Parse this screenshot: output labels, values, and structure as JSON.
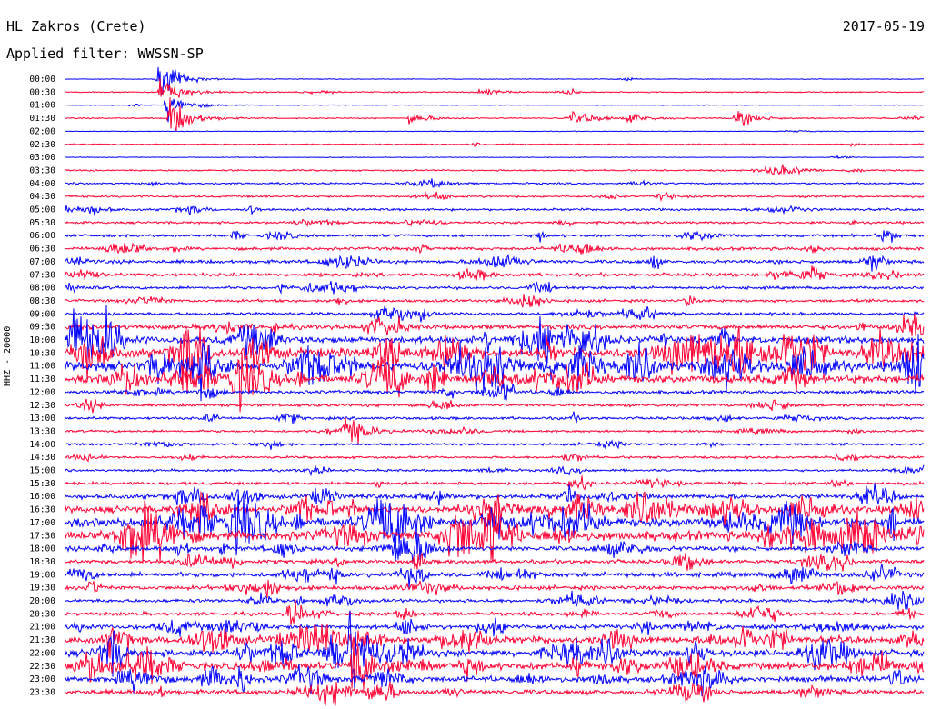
{
  "header": {
    "station": "HL Zakros (Crete)",
    "filter": "Applied filter: WWSSN-SP",
    "date": "2017-05-19",
    "channel": "HHZ - 20000"
  },
  "colors": {
    "trace_a": "#0000ff",
    "trace_b": "#ff0033"
  },
  "chart_data": {
    "type": "line",
    "title": "HL Zakros (Crete)",
    "subtitle": "Applied filter: WWSSN-SP",
    "ylabel": "HHZ - 20000",
    "rows": [
      "00:00",
      "00:30",
      "01:00",
      "01:30",
      "02:00",
      "02:30",
      "03:00",
      "03:30",
      "04:00",
      "04:30",
      "05:00",
      "05:30",
      "06:00",
      "06:30",
      "07:00",
      "07:30",
      "08:00",
      "08:30",
      "09:00",
      "09:30",
      "10:00",
      "10:30",
      "11:00",
      "11:30",
      "12:00",
      "12:30",
      "13:00",
      "13:30",
      "14:00",
      "14:30",
      "15:00",
      "15:30",
      "16:00",
      "16:30",
      "17:00",
      "17:30",
      "18:00",
      "18:30",
      "19:00",
      "19:30",
      "20:00",
      "20:30",
      "21:00",
      "21:30",
      "22:00",
      "22:30",
      "23:00",
      "23:30"
    ],
    "row_colors": [
      "blue",
      "red"
    ],
    "noise_level": [
      0.6,
      1,
      0.6,
      1,
      0.6,
      1,
      0.6,
      1.4,
      1.6,
      1.8,
      2,
      2,
      2.4,
      2.6,
      3,
      3,
      2.4,
      2.4,
      2.6,
      4,
      6,
      8,
      8,
      7,
      3,
      2.6,
      2.4,
      2,
      2,
      2,
      2,
      2.6,
      4,
      6,
      8,
      8,
      4,
      3.5,
      4,
      3.5,
      3,
      3,
      4,
      6,
      6,
      6,
      5,
      4
    ],
    "events": [
      {
        "row": 0,
        "x_min": 3.2,
        "amp": 7
      },
      {
        "row": 0,
        "x_min": 3.3,
        "amp": 10
      },
      {
        "row": 1,
        "x_min": 3.3,
        "amp": 14
      },
      {
        "row": 2,
        "x_min": 3.5,
        "amp": 14
      },
      {
        "row": 3,
        "x_min": 3.6,
        "amp": 20
      },
      {
        "row": 1,
        "x_min": 14.4,
        "amp": 4
      },
      {
        "row": 3,
        "x_min": 12.0,
        "amp": 5
      },
      {
        "row": 3,
        "x_min": 17.7,
        "amp": 5
      },
      {
        "row": 3,
        "x_min": 19.7,
        "amp": 5
      },
      {
        "row": 3,
        "x_min": 23.4,
        "amp": 8
      },
      {
        "row": 27,
        "x_min": 9.7,
        "amp": 18
      },
      {
        "row": 41,
        "x_min": 7.8,
        "amp": 14
      },
      {
        "row": 44,
        "x_min": 9.9,
        "amp": 28
      },
      {
        "row": 45,
        "x_min": 10.0,
        "amp": 30
      }
    ]
  }
}
